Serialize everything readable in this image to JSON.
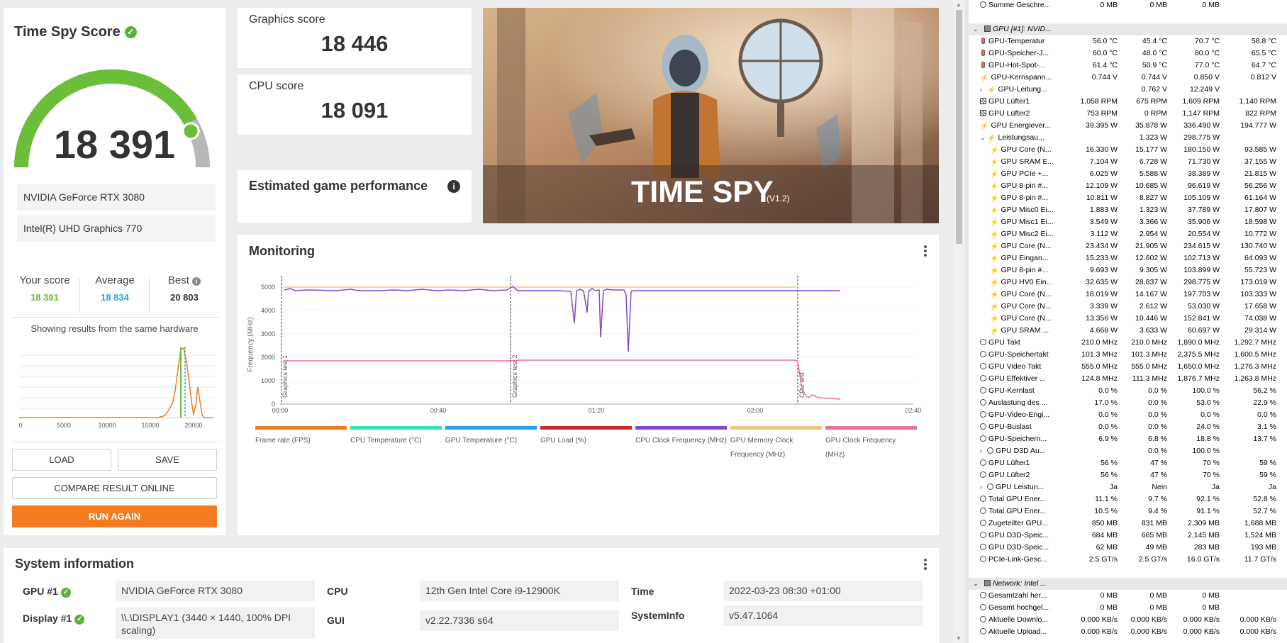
{
  "score": {
    "title": "Time Spy Score",
    "value": "18 391",
    "gpu": "NVIDIA GeForce RTX 3080",
    "igpu": "Intel(R) UHD Graphics 770",
    "your_label": "Your score",
    "your_value": "18 391",
    "avg_label": "Average",
    "avg_value": "18 834",
    "best_label": "Best",
    "best_value": "20 803",
    "same_hw": "Showing results from the same hardware",
    "load": "LOAD",
    "save": "SAVE",
    "compare": "COMPARE RESULT ONLINE",
    "run_again": "RUN AGAIN",
    "dist_ticks": [
      "0",
      "5000",
      "10000",
      "15000",
      "20000"
    ],
    "colors": {
      "green": "#6abe3a",
      "orange": "#f47b20",
      "blue": "#2aa6dd"
    }
  },
  "graphics": {
    "label": "Graphics score",
    "value": "18 446"
  },
  "cpu": {
    "label": "CPU score",
    "value": "18 091"
  },
  "estimated": {
    "title": "Estimated game performance"
  },
  "banner": {
    "title": "TIME SPY",
    "version": "(V1.2)"
  },
  "monitoring": {
    "title": "Monitoring",
    "ylabel": "Frequency (MHz)",
    "yticks": [
      "5000",
      "4000",
      "3000",
      "2000",
      "1000",
      "0"
    ],
    "xticks": [
      "00:00",
      "00:40",
      "01:20",
      "02:00",
      "02:40"
    ],
    "markers": [
      "Graphics test 1",
      "Graphics test 2",
      "CPU test"
    ],
    "legend": [
      {
        "label": "Frame rate (FPS)",
        "color": "#f47b20"
      },
      {
        "label": "CPU Temperature (°C)",
        "color": "#37e0b4"
      },
      {
        "label": "GPU Temperature (°C)",
        "color": "#26a3e6"
      },
      {
        "label": "GPU Load (%)",
        "color": "#c8282e"
      },
      {
        "label": "CPU Clock Frequency (MHz)",
        "color": "#8a46c8"
      },
      {
        "label": "GPU Memory Clock Frequency (MHz)",
        "color": "#e8c882"
      },
      {
        "label": "GPU Clock Frequency (MHz)",
        "color": "#e8729a"
      }
    ]
  },
  "system": {
    "title": "System information",
    "gpu_label": "GPU #1",
    "gpu_value": "NVIDIA GeForce RTX 3080",
    "display_label": "Display #1",
    "display_value": "\\\\.\\DISPLAY1 (3440 × 1440, 100% DPI scaling)",
    "cpu_label": "CPU",
    "cpu_value": "12th Gen Intel Core i9-12900K",
    "gui_label": "GUI",
    "gui_value": "v2.22.7336 s64",
    "time_label": "Time",
    "time_value": "2022-03-23 08:30 +01:00",
    "sysinfo_label": "SystemInfo",
    "sysinfo_value": "v5.47.1064"
  },
  "hwinfo": {
    "rows": [
      {
        "icon": "clock",
        "ind": 0,
        "name": "Summe Geschre...",
        "c": [
          "0 MB",
          "0 MB",
          "0 MB",
          ""
        ]
      },
      {
        "type": "blank"
      },
      {
        "type": "group",
        "name": "GPU [#1]: NVID..."
      },
      {
        "icon": "therm",
        "ind": 1,
        "name": "GPU-Temperatur",
        "c": [
          "56.0 °C",
          "45.4 °C",
          "70.7 °C",
          "58.8 °C"
        ]
      },
      {
        "icon": "therm",
        "ind": 1,
        "name": "GPU-Speicher-J...",
        "c": [
          "60.0 °C",
          "48.0 °C",
          "80.0 °C",
          "65.5 °C"
        ]
      },
      {
        "icon": "therm",
        "ind": 1,
        "name": "GPU-Hot-Spot-...",
        "c": [
          "61.4 °C",
          "50.9 °C",
          "77.0 °C",
          "64.7 °C"
        ]
      },
      {
        "icon": "bolt",
        "ind": 1,
        "name": "GPU-Kernspann...",
        "c": [
          "0.744 V",
          "0.744 V",
          "0.850 V",
          "0.812 V"
        ]
      },
      {
        "icon": "bolt",
        "ind": 1,
        "arrow": "›",
        "name": "GPU-Leitung...",
        "c": [
          "",
          "0.762 V",
          "12.249 V",
          ""
        ]
      },
      {
        "icon": "fan",
        "ind": 1,
        "name": "GPU Lüfter1",
        "c": [
          "1,058 RPM",
          "675 RPM",
          "1,609 RPM",
          "1,140 RPM"
        ]
      },
      {
        "icon": "fan",
        "ind": 1,
        "name": "GPU Lüfter2",
        "c": [
          "753 RPM",
          "0 RPM",
          "1,147 RPM",
          "822 RPM"
        ]
      },
      {
        "icon": "bolt",
        "ind": 1,
        "name": "GPU Energiever...",
        "c": [
          "39.395 W",
          "35.878 W",
          "336.490 W",
          "194.777 W"
        ]
      },
      {
        "icon": "bolt",
        "ind": 1,
        "arrow": "⌄",
        "name": "Leistungsau...",
        "c": [
          "",
          "1.323 W",
          "298.775 W",
          ""
        ]
      },
      {
        "icon": "bolt",
        "ind": 2,
        "name": "GPU Core (N...",
        "c": [
          "16.330 W",
          "15.177 W",
          "180.150 W",
          "93.585 W"
        ]
      },
      {
        "icon": "bolt",
        "ind": 2,
        "name": "GPU SRAM E...",
        "c": [
          "7.104 W",
          "6.728 W",
          "71.730 W",
          "37.155 W"
        ]
      },
      {
        "icon": "bolt",
        "ind": 2,
        "name": "GPU PCIe +...",
        "c": [
          "6.025 W",
          "5.588 W",
          "38.389 W",
          "21.815 W"
        ]
      },
      {
        "icon": "bolt",
        "ind": 2,
        "name": "GPU 8-pin #...",
        "c": [
          "12.109 W",
          "10.685 W",
          "96.619 W",
          "56.256 W"
        ]
      },
      {
        "icon": "bolt",
        "ind": 2,
        "name": "GPU 8-pin #...",
        "c": [
          "10.811 W",
          "8.827 W",
          "105.109 W",
          "61.164 W"
        ]
      },
      {
        "icon": "bolt",
        "ind": 2,
        "name": "GPU Misc0 Ei...",
        "c": [
          "1.883 W",
          "1.323 W",
          "37.789 W",
          "17.807 W"
        ]
      },
      {
        "icon": "bolt",
        "ind": 2,
        "name": "GPU Misc1 Ei...",
        "c": [
          "3.549 W",
          "3.366 W",
          "35.906 W",
          "18.598 W"
        ]
      },
      {
        "icon": "bolt",
        "ind": 2,
        "name": "GPU Misc2 Ei...",
        "c": [
          "3.112 W",
          "2.954 W",
          "20.554 W",
          "10.772 W"
        ]
      },
      {
        "icon": "bolt",
        "ind": 2,
        "name": "GPU Core (N...",
        "c": [
          "23.434 W",
          "21.905 W",
          "234.615 W",
          "130.740 W"
        ]
      },
      {
        "icon": "bolt",
        "ind": 2,
        "name": "GPU Eingan...",
        "c": [
          "15.233 W",
          "12.602 W",
          "102.713 W",
          "64.093 W"
        ]
      },
      {
        "icon": "bolt",
        "ind": 2,
        "name": "GPU 8-pin #...",
        "c": [
          "9.693 W",
          "9.305 W",
          "103.899 W",
          "55.723 W"
        ]
      },
      {
        "icon": "bolt",
        "ind": 2,
        "name": "GPU HV0 Ein...",
        "c": [
          "32.635 W",
          "28.837 W",
          "298.775 W",
          "173.019 W"
        ]
      },
      {
        "icon": "bolt",
        "ind": 2,
        "name": "GPU Core (N...",
        "c": [
          "18.019 W",
          "14.167 W",
          "197.703 W",
          "103.333 W"
        ]
      },
      {
        "icon": "bolt",
        "ind": 2,
        "name": "GPU Core (N...",
        "c": [
          "3.339 W",
          "2.612 W",
          "53.030 W",
          "17.658 W"
        ]
      },
      {
        "icon": "bolt",
        "ind": 2,
        "name": "GPU Core (N...",
        "c": [
          "13.356 W",
          "10.446 W",
          "152.841 W",
          "74.038 W"
        ]
      },
      {
        "icon": "bolt",
        "ind": 2,
        "name": "GPU SRAM ...",
        "c": [
          "4.668 W",
          "3.633 W",
          "60.697 W",
          "29.314 W"
        ]
      },
      {
        "icon": "clock",
        "ind": 1,
        "name": "GPU Takt",
        "c": [
          "210.0 MHz",
          "210.0 MHz",
          "1,890.0 MHz",
          "1,292.7 MHz"
        ]
      },
      {
        "icon": "clock",
        "ind": 1,
        "name": "GPU-Speichertakt",
        "c": [
          "101.3 MHz",
          "101.3 MHz",
          "2,375.5 MHz",
          "1,600.5 MHz"
        ]
      },
      {
        "icon": "clock",
        "ind": 1,
        "name": "GPU Video Takt",
        "c": [
          "555.0 MHz",
          "555.0 MHz",
          "1,650.0 MHz",
          "1,276.3 MHz"
        ]
      },
      {
        "icon": "clock",
        "ind": 1,
        "name": "GPU Effektiver ...",
        "c": [
          "124.8 MHz",
          "111.3 MHz",
          "1,876.7 MHz",
          "1,263.8 MHz"
        ]
      },
      {
        "icon": "clock",
        "ind": 1,
        "name": "GPU-Kernlast",
        "c": [
          "0.0 %",
          "0.0 %",
          "100.0 %",
          "56.2 %"
        ]
      },
      {
        "icon": "clock",
        "ind": 1,
        "name": "Auslastung des ...",
        "c": [
          "17.0 %",
          "0.0 %",
          "53.0 %",
          "22.9 %"
        ]
      },
      {
        "icon": "clock",
        "ind": 1,
        "name": "GPU-Video-Engi...",
        "c": [
          "0.0 %",
          "0.0 %",
          "0.0 %",
          "0.0 %"
        ]
      },
      {
        "icon": "clock",
        "ind": 1,
        "name": "GPU-Buslast",
        "c": [
          "0.0 %",
          "0.0 %",
          "24.0 %",
          "3.1 %"
        ]
      },
      {
        "icon": "clock",
        "ind": 1,
        "name": "GPU-Speichern...",
        "c": [
          "6.9 %",
          "6.8 %",
          "18.8 %",
          "13.7 %"
        ]
      },
      {
        "icon": "clock",
        "ind": 1,
        "arrow": "›",
        "name": "GPU D3D Au...",
        "c": [
          "",
          "0.0 %",
          "100.0 %",
          ""
        ]
      },
      {
        "icon": "clock",
        "ind": 1,
        "name": "GPU Lüfter1",
        "c": [
          "56 %",
          "47 %",
          "70 %",
          "59 %"
        ]
      },
      {
        "icon": "clock",
        "ind": 1,
        "name": "GPU Lüfter2",
        "c": [
          "56 %",
          "47 %",
          "70 %",
          "59 %"
        ]
      },
      {
        "icon": "clock",
        "ind": 1,
        "arrow": "›",
        "name": "GPU Leistun...",
        "c": [
          "Ja",
          "Nein",
          "Ja",
          "Ja"
        ]
      },
      {
        "icon": "clock",
        "ind": 1,
        "name": "Total GPU Ener...",
        "c": [
          "11.1 %",
          "9.7 %",
          "92.1 %",
          "52.8 %"
        ]
      },
      {
        "icon": "clock",
        "ind": 1,
        "name": "Total GPU Ener...",
        "c": [
          "10.5 %",
          "9.4 %",
          "91.1 %",
          "52.7 %"
        ]
      },
      {
        "icon": "clock",
        "ind": 1,
        "name": "Zugeteilter GPU...",
        "c": [
          "850 MB",
          "831 MB",
          "2,309 MB",
          "1,688 MB"
        ]
      },
      {
        "icon": "clock",
        "ind": 1,
        "name": "GPU D3D-Speic...",
        "c": [
          "684 MB",
          "665 MB",
          "2,145 MB",
          "1,524 MB"
        ]
      },
      {
        "icon": "clock",
        "ind": 1,
        "name": "GPU D3D-Speic...",
        "c": [
          "62 MB",
          "49 MB",
          "283 MB",
          "193 MB"
        ]
      },
      {
        "icon": "clock",
        "ind": 1,
        "name": "PCIe-Link-Gesc...",
        "c": [
          "2.5 GT/s",
          "2.5 GT/s",
          "16.0 GT/s",
          "11.7 GT/s"
        ]
      },
      {
        "type": "blank"
      },
      {
        "type": "group",
        "name": "Network: Intel ..."
      },
      {
        "icon": "clock",
        "ind": 1,
        "name": "Gesamtzahl her...",
        "c": [
          "0 MB",
          "0 MB",
          "0 MB",
          ""
        ]
      },
      {
        "icon": "clock",
        "ind": 1,
        "name": "Gesamt hochgel...",
        "c": [
          "0 MB",
          "0 MB",
          "0 MB",
          ""
        ]
      },
      {
        "icon": "clock",
        "ind": 1,
        "name": "Aktuelle Downlo...",
        "c": [
          "0.000 KB/s",
          "0.000 KB/s",
          "0.000 KB/s",
          "0.000 KB/s"
        ]
      },
      {
        "icon": "clock",
        "ind": 1,
        "name": "Aktuelle Upload...",
        "c": [
          "0.000 KB/s",
          "0.000 KB/s",
          "0.000 KB/s",
          "0.000 KB/s"
        ]
      }
    ]
  }
}
